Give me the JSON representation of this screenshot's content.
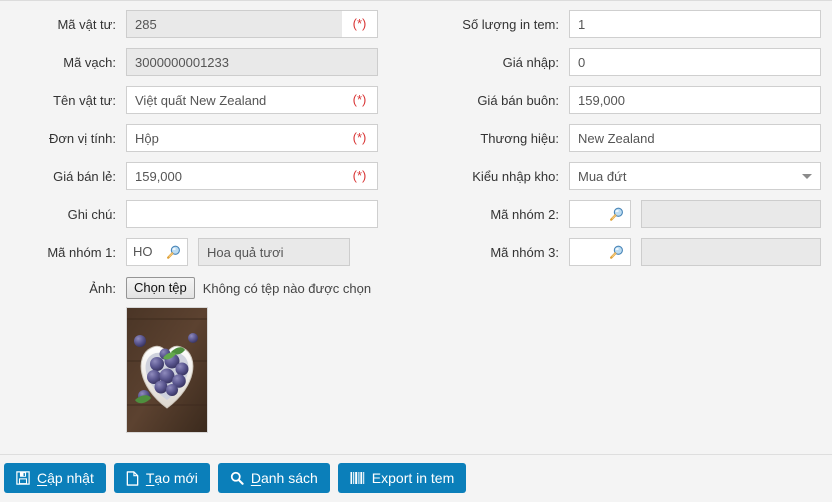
{
  "form": {
    "left_fields": [
      {
        "label": "Mã vật tư:",
        "value": "285",
        "readonly": true,
        "required": true
      },
      {
        "label": "Mã vạch:",
        "value": "3000000001233",
        "readonly": true,
        "required": false
      },
      {
        "label": "Tên vật tư:",
        "value": "Việt quất New Zealand",
        "readonly": false,
        "required": true
      },
      {
        "label": "Đơn vị tính:",
        "value": "Hộp",
        "readonly": false,
        "required": true
      },
      {
        "label": "Giá bán lẻ:",
        "value": "159,000",
        "readonly": false,
        "required": true
      },
      {
        "label": "Ghi chú:",
        "value": "",
        "readonly": false,
        "required": false
      }
    ],
    "group1": {
      "label": "Mã nhóm 1:",
      "code": "HO",
      "name": "Hoa quả tươi",
      "icon": "magnifier-icon"
    },
    "image": {
      "label": "Ảnh:",
      "choose_button": "Chọn tệp",
      "no_file_text": "Không có tệp nào được chọn",
      "thumbnail_alt": "Blueberries in white heart bowl"
    },
    "right_fields": [
      {
        "label": "Số lượng in tem:",
        "value": "1"
      },
      {
        "label": "Giá nhập:",
        "value": "0"
      },
      {
        "label": "Giá bán buôn:",
        "value": "159,000"
      },
      {
        "label": "Thương hiệu:",
        "value": "New Zealand"
      }
    ],
    "warehouse_type": {
      "label": "Kiểu nhập kho:",
      "value": "Mua đứt",
      "options": [
        "Mua đứt"
      ]
    },
    "group2": {
      "label": "Mã nhóm 2:",
      "code": "",
      "name": "",
      "icon": "magnifier-icon"
    },
    "group3": {
      "label": "Mã nhóm 3:",
      "code": "",
      "name": "",
      "icon": "magnifier-icon"
    },
    "required_marker": "(*)"
  },
  "buttons": [
    {
      "label_pre": "",
      "accel": "C",
      "label_post": "ập nhật",
      "icon": "save-floppy-icon"
    },
    {
      "label_pre": "",
      "accel": "T",
      "label_post": "ạo mới",
      "icon": "new-file-icon"
    },
    {
      "label_pre": "",
      "accel": "D",
      "label_post": "anh sách",
      "icon": "search-icon"
    },
    {
      "label_pre": "Export in tem",
      "accel": "",
      "label_post": "",
      "icon": "barcode-icon"
    }
  ],
  "colors": {
    "accent": "#0b7fba",
    "required": "#d93636",
    "page_bg": "#f4f4f4",
    "readonly_bg": "#e9e9e9"
  }
}
